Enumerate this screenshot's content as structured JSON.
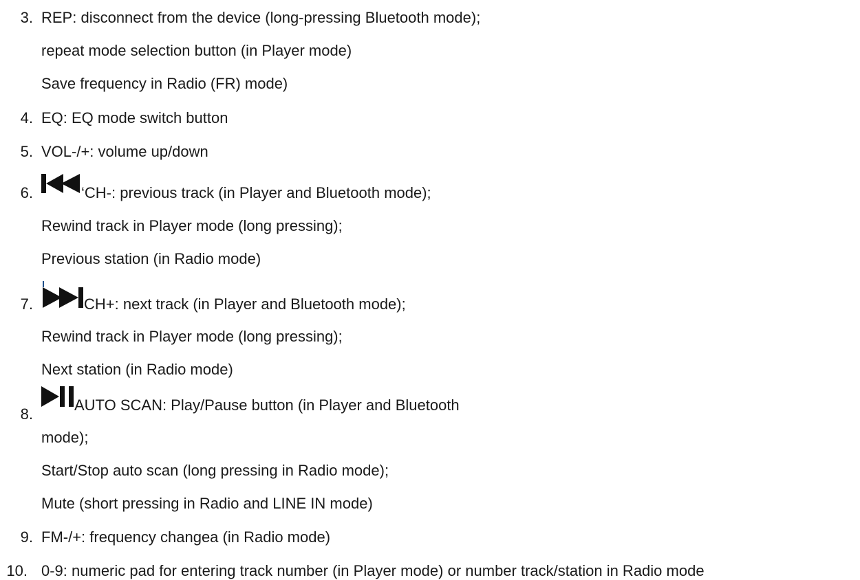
{
  "items": [
    {
      "number": "3.",
      "lines": [
        "REP: disconnect from the device (long-pressing Bluetooth mode);",
        "repeat mode selection button (in Player mode)",
        "Save frequency in Radio (FR) mode)"
      ]
    },
    {
      "number": "4.",
      "lines": [
        "EQ: EQ mode switch button"
      ]
    },
    {
      "number": "5.",
      "lines": [
        "VOL-/+: volume up/down"
      ]
    },
    {
      "number": "6.",
      "icon": "previous-track-icon",
      "lines": [
        "‘CH-: previous track (in Player and Bluetooth mode);",
        "Rewind track in Player mode (long pressing);",
        "Previous station (in Radio mode)"
      ]
    },
    {
      "number": "7.",
      "icon": "next-track-icon",
      "lines": [
        "CH+: next track (in Player and Bluetooth mode);",
        "Rewind track in Player mode (long pressing);",
        "Next station (in Radio mode)"
      ]
    },
    {
      "number": "8.",
      "icon": "play-pause-icon",
      "lines": [
        " AUTO SCAN: Play/Pause button (in Player and Bluetooth",
        "mode);",
        "Start/Stop auto scan (long pressing in Radio mode);",
        "Mute (short pressing in Radio and LINE IN mode)"
      ]
    },
    {
      "number": "9.",
      "lines": [
        "FM-/+: frequency changea (in Radio mode)"
      ]
    },
    {
      "number": "10.",
      "lines": [
        "0-9: numeric pad for entering track number (in Player mode) or number track/station in Radio mode"
      ]
    }
  ],
  "colors": {
    "text": "#1a1a1a",
    "tick": "#1f4f8a"
  }
}
